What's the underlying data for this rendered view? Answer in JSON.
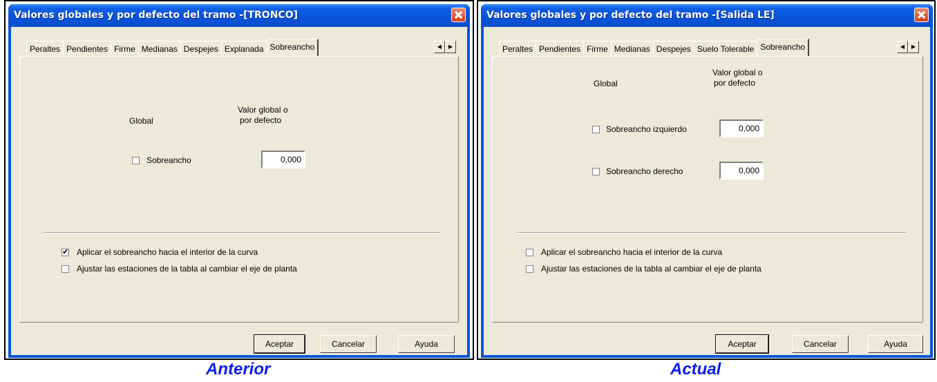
{
  "left": {
    "title": "Valores globales y por defecto del tramo -[TRONCO]",
    "tabs": [
      "Peraltes",
      "Pendientes",
      "Firme",
      "Medianas",
      "Despejes",
      "Explanada",
      "Sobreancho"
    ],
    "active_tab": "Sobreancho",
    "col_global": "Global",
    "col_value_1": "Valor global o",
    "col_value_2": "por defecto",
    "row1_label": "Sobreancho",
    "row1_checked": false,
    "row1_value": "0,000",
    "opt1_label": "Aplicar el sobreancho hacia el interior de la curva",
    "opt1_checked": true,
    "opt2_label": "Ajustar las estaciones de la tabla al cambiar el eje de planta",
    "opt2_checked": false,
    "ok": "Aceptar",
    "cancel": "Cancelar",
    "help": "Ayuda",
    "caption": "Anterior"
  },
  "right": {
    "title": "Valores globales y por defecto del tramo -[Salida LE]",
    "tabs": [
      "Peraltes",
      "Pendientes",
      "Firme",
      "Medianas",
      "Despejes",
      "Suelo Tolerable",
      "Sobreancho"
    ],
    "active_tab": "Sobreancho",
    "col_global": "Global",
    "col_value_1": "Valor global o",
    "col_value_2": "por defecto",
    "row1_label": "Sobreancho izquierdo",
    "row1_checked": false,
    "row1_value": "0,000",
    "row2_label": "Sobreancho derecho",
    "row2_checked": false,
    "row2_value": "0,000",
    "opt1_label": "Aplicar el sobreancho hacia el interior de la curva",
    "opt1_checked": false,
    "opt2_label": "Ajustar las estaciones de la tabla al cambiar el eje de planta",
    "opt2_checked": false,
    "ok": "Aceptar",
    "cancel": "Cancelar",
    "help": "Ayuda",
    "caption": "Actual"
  },
  "icons": {
    "scroll_left": "◀",
    "scroll_right": "▶"
  },
  "colors": {
    "title_bar": "#0a57d6",
    "caption_text": "#0a1ef0",
    "dialog_face": "#ece9d8"
  }
}
